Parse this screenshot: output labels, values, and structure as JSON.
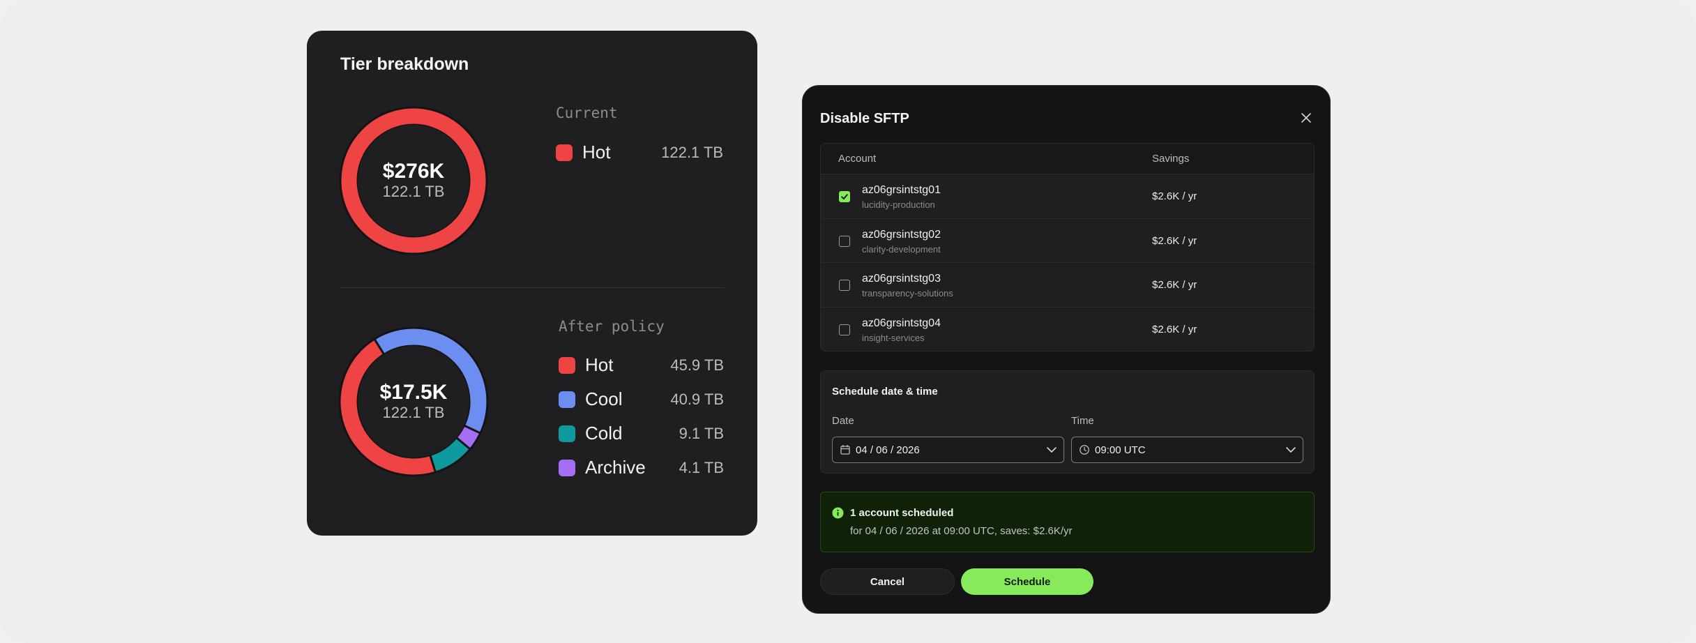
{
  "tier_card": {
    "title": "Tier breakdown",
    "current": {
      "label": "Current",
      "total": "$276K",
      "size": "122.1 TB",
      "legend": [
        {
          "name": "Hot",
          "value": "122.1 TB",
          "color": "#ef4444",
          "tb": 122.1
        }
      ]
    },
    "after": {
      "label": "After policy",
      "total": "$17.5K",
      "size": "122.1 TB",
      "legend": [
        {
          "name": "Hot",
          "value": "45.9 TB",
          "color": "#ef4444",
          "tb": 45.9
        },
        {
          "name": "Cool",
          "value": "40.9 TB",
          "color": "#6b8ef0",
          "tb": 40.9
        },
        {
          "name": "Cold",
          "value": "9.1 TB",
          "color": "#0f9a9e",
          "tb": 9.1
        },
        {
          "name": "Archive",
          "value": "4.1 TB",
          "color": "#a56ef5",
          "tb": 4.1
        }
      ]
    }
  },
  "modal": {
    "title": "Disable SFTP",
    "close_icon": "close-icon",
    "table": {
      "headers": {
        "account": "Account",
        "savings": "Savings"
      },
      "rows": [
        {
          "name": "az06grsintstg01",
          "sub": "lucidity-production",
          "savings": "$2.6K / yr",
          "checked": true
        },
        {
          "name": "az06grsintstg02",
          "sub": "clarity-development",
          "savings": "$2.6K / yr",
          "checked": false
        },
        {
          "name": "az06grsintstg03",
          "sub": "transparency-solutions",
          "savings": "$2.6K / yr",
          "checked": false
        },
        {
          "name": "az06grsintstg04",
          "sub": "insight-services",
          "savings": "$2.6K / yr",
          "checked": false
        }
      ]
    },
    "schedule": {
      "title": "Schedule date & time",
      "date_label": "Date",
      "date_value": "04 / 06 / 2026",
      "time_label": "Time",
      "time_value": "09:00 UTC"
    },
    "notice": {
      "title": "1 account scheduled",
      "text": "for 04 / 06 / 2026 at 09:00 UTC, saves: $2.6K/yr"
    },
    "buttons": {
      "cancel": "Cancel",
      "schedule": "Schedule"
    },
    "colors": {
      "accent": "#86ea5a"
    }
  }
}
